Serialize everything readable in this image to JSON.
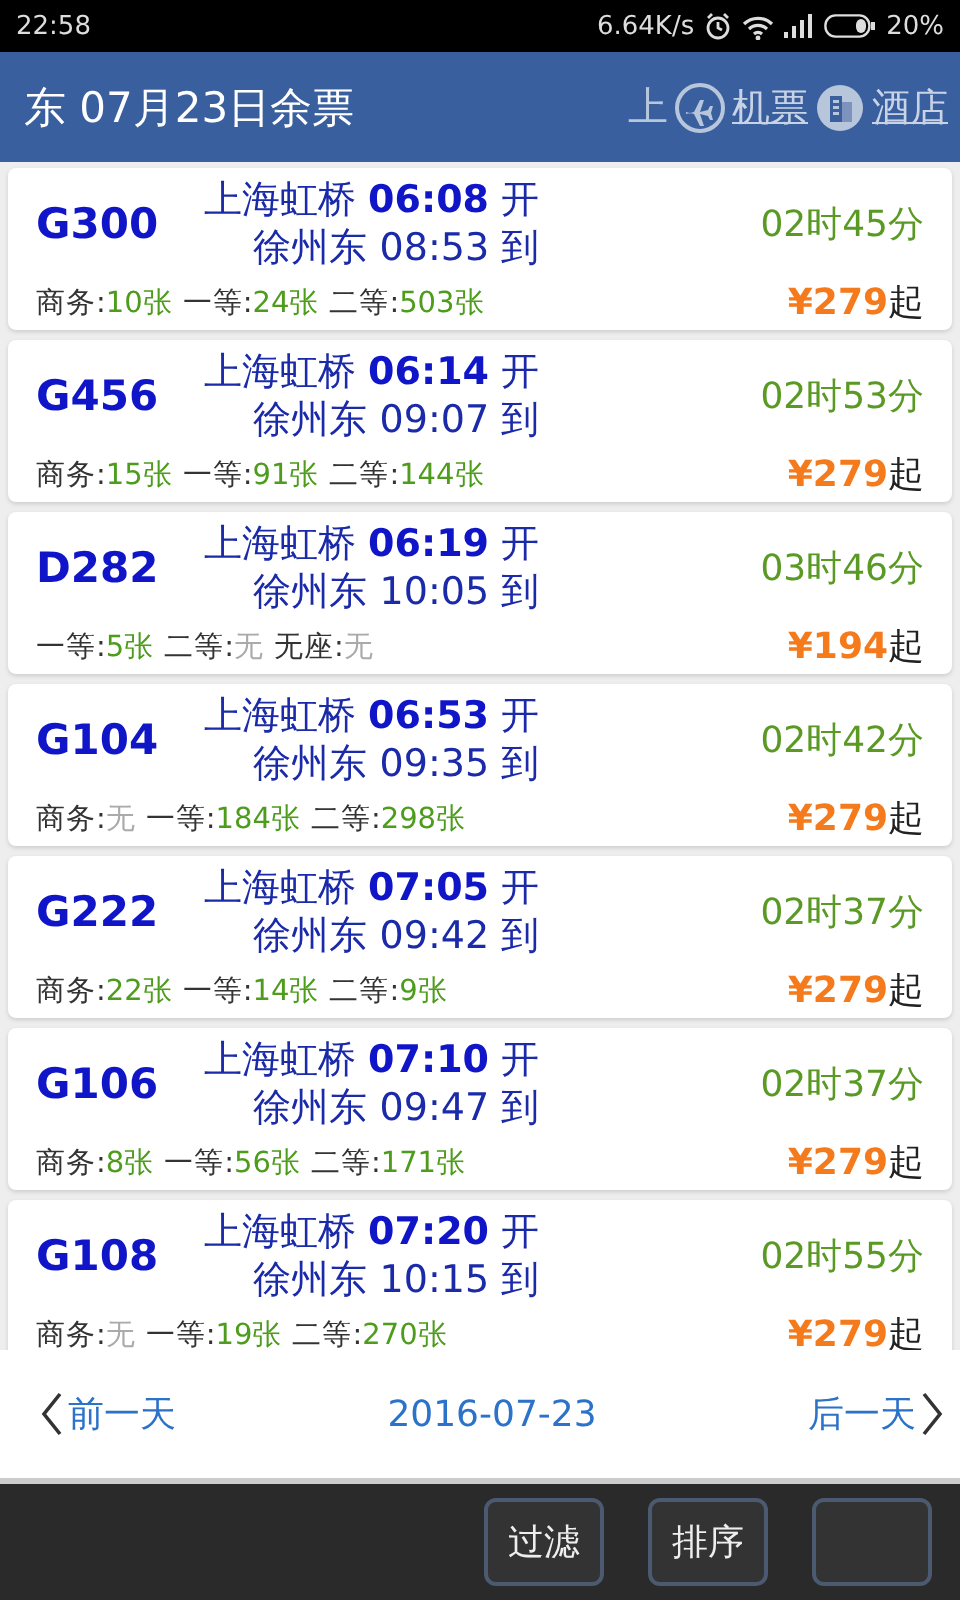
{
  "status_bar": {
    "time": "22:58",
    "speed": "6.64K/s",
    "battery": "20%"
  },
  "header": {
    "title": "东 07月23日余票",
    "cut_text": "上",
    "links": [
      "机票",
      "酒店"
    ]
  },
  "trains": [
    {
      "number": "G300",
      "from": "上海虹桥",
      "depart": "06:08",
      "depart_mark": "开",
      "to": "徐州东",
      "arrive": "08:53",
      "arrive_mark": "到",
      "duration": "02时45分",
      "price": "¥279",
      "price_suffix": "起",
      "seats": [
        {
          "class": "商务:",
          "count": "10张",
          "available": true
        },
        {
          "class": "一等:",
          "count": "24张",
          "available": true
        },
        {
          "class": "二等:",
          "count": "503张",
          "available": true
        }
      ]
    },
    {
      "number": "G456",
      "from": "上海虹桥",
      "depart": "06:14",
      "depart_mark": "开",
      "to": "徐州东",
      "arrive": "09:07",
      "arrive_mark": "到",
      "duration": "02时53分",
      "price": "¥279",
      "price_suffix": "起",
      "seats": [
        {
          "class": "商务:",
          "count": "15张",
          "available": true
        },
        {
          "class": "一等:",
          "count": "91张",
          "available": true
        },
        {
          "class": "二等:",
          "count": "144张",
          "available": true
        }
      ]
    },
    {
      "number": "D282",
      "from": "上海虹桥",
      "depart": "06:19",
      "depart_mark": "开",
      "to": "徐州东",
      "arrive": "10:05",
      "arrive_mark": "到",
      "duration": "03时46分",
      "price": "¥194",
      "price_suffix": "起",
      "seats": [
        {
          "class": "一等:",
          "count": "5张",
          "available": true
        },
        {
          "class": "二等:",
          "count": "无",
          "available": false
        },
        {
          "class": "无座:",
          "count": "无",
          "available": false
        }
      ]
    },
    {
      "number": "G104",
      "from": "上海虹桥",
      "depart": "06:53",
      "depart_mark": "开",
      "to": "徐州东",
      "arrive": "09:35",
      "arrive_mark": "到",
      "duration": "02时42分",
      "price": "¥279",
      "price_suffix": "起",
      "seats": [
        {
          "class": "商务:",
          "count": "无",
          "available": false
        },
        {
          "class": "一等:",
          "count": "184张",
          "available": true
        },
        {
          "class": "二等:",
          "count": "298张",
          "available": true
        }
      ]
    },
    {
      "number": "G222",
      "from": "上海虹桥",
      "depart": "07:05",
      "depart_mark": "开",
      "to": "徐州东",
      "arrive": "09:42",
      "arrive_mark": "到",
      "duration": "02时37分",
      "price": "¥279",
      "price_suffix": "起",
      "seats": [
        {
          "class": "商务:",
          "count": "22张",
          "available": true
        },
        {
          "class": "一等:",
          "count": "14张",
          "available": true
        },
        {
          "class": "二等:",
          "count": "9张",
          "available": true
        }
      ]
    },
    {
      "number": "G106",
      "from": "上海虹桥",
      "depart": "07:10",
      "depart_mark": "开",
      "to": "徐州东",
      "arrive": "09:47",
      "arrive_mark": "到",
      "duration": "02时37分",
      "price": "¥279",
      "price_suffix": "起",
      "seats": [
        {
          "class": "商务:",
          "count": "8张",
          "available": true
        },
        {
          "class": "一等:",
          "count": "56张",
          "available": true
        },
        {
          "class": "二等:",
          "count": "171张",
          "available": true
        }
      ]
    },
    {
      "number": "G108",
      "from": "上海虹桥",
      "depart": "07:20",
      "depart_mark": "开",
      "to": "徐州东",
      "arrive": "10:15",
      "arrive_mark": "到",
      "duration": "02时55分",
      "price": "¥279",
      "price_suffix": "起",
      "seats": [
        {
          "class": "商务:",
          "count": "无",
          "available": false
        },
        {
          "class": "一等:",
          "count": "19张",
          "available": true
        },
        {
          "class": "二等:",
          "count": "270张",
          "available": true
        }
      ]
    }
  ],
  "date_nav": {
    "prev": "前一天",
    "date": "2016-07-23",
    "next": "后一天"
  },
  "toolbar": {
    "buttons": [
      {
        "label": "过滤"
      },
      {
        "label": "排序"
      }
    ]
  }
}
